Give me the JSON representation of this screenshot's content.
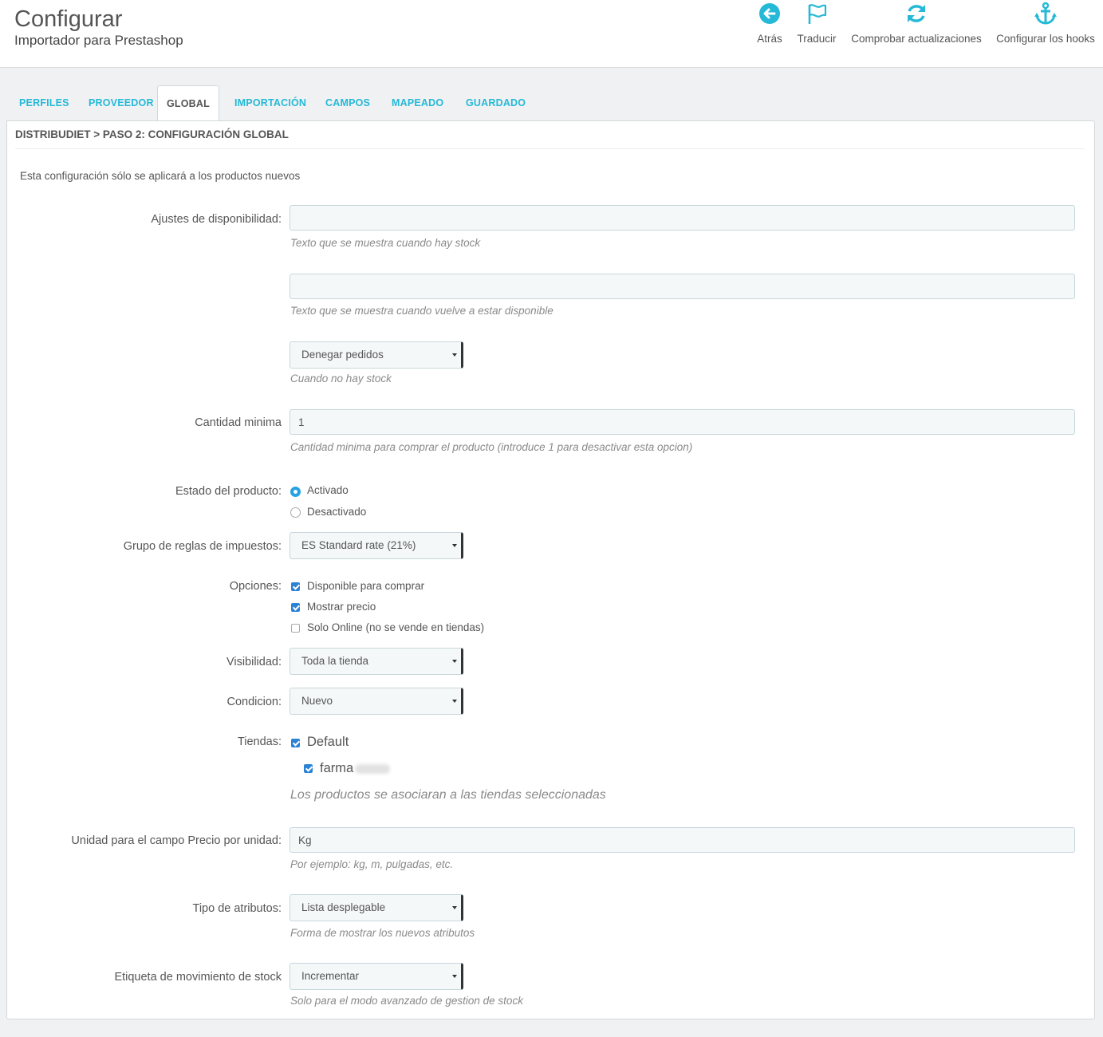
{
  "header": {
    "title": "Configurar",
    "subtitle": "Importador para Prestashop",
    "toolbar": [
      {
        "label": "Atrás",
        "icon": "back-circle-icon"
      },
      {
        "label": "Traducir",
        "icon": "flag-icon"
      },
      {
        "label": "Comprobar actualizaciones",
        "icon": "refresh-icon"
      },
      {
        "label": "Configurar los hooks",
        "icon": "anchor-icon"
      }
    ]
  },
  "tabs": [
    "Perfiles",
    "Proveedor",
    "Global",
    "Importación",
    "Campos",
    "Mapeado",
    "Guardado"
  ],
  "active_tab": "Global",
  "panel": {
    "heading": "Distribudiet > Paso 2: Configuración global",
    "intro": "Esta configuración sólo se aplicará a los productos nuevos"
  },
  "form": {
    "availability_label": "Ajustes de disponibilidad:",
    "in_stock_value": "",
    "in_stock_help": "Texto que se muestra cuando hay stock",
    "backorder_value": "",
    "backorder_help": "Texto que se muestra cuando vuelve a estar disponible",
    "out_of_stock_select": "Denegar pedidos",
    "out_of_stock_help": "Cuando no hay stock",
    "min_qty_label": "Cantidad minima",
    "min_qty_value": "1",
    "min_qty_help": "Cantidad minima para comprar el producto (introduce 1 para desactivar esta opcion)",
    "status_label": "Estado del producto:",
    "status_options": [
      "Activado",
      "Desactivado"
    ],
    "status_selected": "Activado",
    "tax_label": "Grupo de reglas de impuestos:",
    "tax_value": "ES Standard rate (21%)",
    "options_label": "Opciones:",
    "options": [
      {
        "label": "Disponible para comprar",
        "checked": true
      },
      {
        "label": "Mostrar precio",
        "checked": true
      },
      {
        "label": "Solo Online (no se vende en tiendas)",
        "checked": false
      }
    ],
    "visibility_label": "Visibilidad:",
    "visibility_value": "Toda la tienda",
    "condition_label": "Condicion:",
    "condition_value": "Nuevo",
    "shops_label": "Tiendas:",
    "shop_default": "Default",
    "shop_second": "farma",
    "shops_help": "Los productos se asociaran a las tiendas seleccionadas",
    "unit_label": "Unidad para el campo Precio por unidad:",
    "unit_value": "Kg",
    "unit_help": "Por ejemplo: kg, m, pulgadas, etc.",
    "attr_label": "Tipo de atributos:",
    "attr_value": "Lista desplegable",
    "attr_help": "Forma de mostrar los nuevos atributos",
    "stock_label": "Etiqueta de movimiento de stock",
    "stock_value": "Incrementar",
    "stock_help": "Solo para el modo avanzado de gestion de stock"
  },
  "colors": {
    "accent": "#25b9d7",
    "checkbox": "#2b83d6",
    "radio": "#25a2e5"
  }
}
